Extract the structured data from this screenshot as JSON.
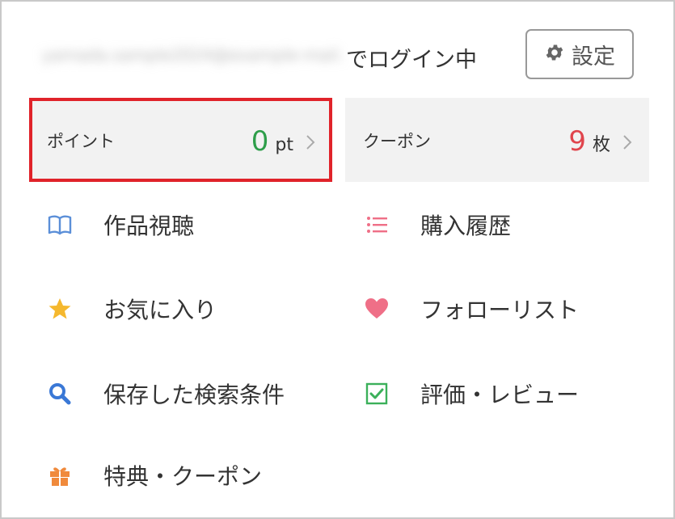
{
  "header": {
    "email_masked": "yamada.sample2024@example-mail.com",
    "login_status": "でログイン中",
    "settings_label": "設定",
    "settings_icon": "gear-icon"
  },
  "stats": {
    "points": {
      "label": "ポイント",
      "value": "0",
      "unit": "pt",
      "value_color": "#2e9e4a",
      "highlighted": true,
      "highlight_color": "#e0232a"
    },
    "coupons": {
      "label": "クーポン",
      "value": "9",
      "unit": "枚",
      "value_color": "#e0454d"
    }
  },
  "menu": {
    "left": [
      {
        "label": "作品視聴",
        "icon": "open-book-icon",
        "color": "#5b8fd8"
      },
      {
        "label": "お気に入り",
        "icon": "star-icon",
        "color": "#f5b82e"
      },
      {
        "label": "保存した検索条件",
        "icon": "search-icon",
        "color": "#3a78d6"
      },
      {
        "label": "特典・クーポン",
        "icon": "gift-icon",
        "color": "#f08a3c"
      }
    ],
    "right": [
      {
        "label": "購入履歴",
        "icon": "list-icon",
        "color": "#ef6f87"
      },
      {
        "label": "フォローリスト",
        "icon": "heart-icon",
        "color": "#ef6f87"
      },
      {
        "label": "評価・レビュー",
        "icon": "checkbox-icon",
        "color": "#3bb05a"
      }
    ]
  }
}
